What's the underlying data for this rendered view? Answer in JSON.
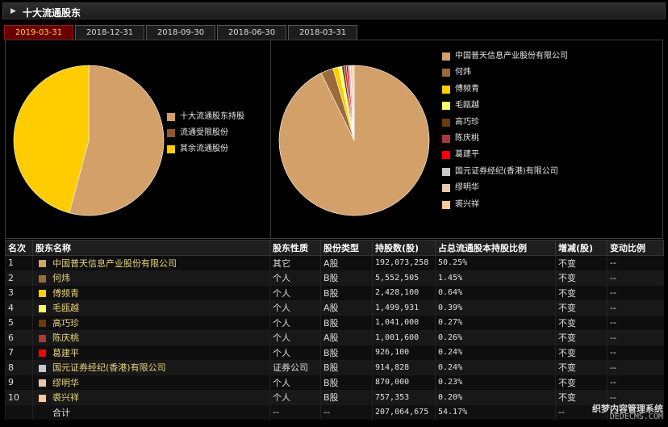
{
  "header": {
    "title": "十大流通股东"
  },
  "tabs": [
    {
      "label": "2019-03-31",
      "active": true
    },
    {
      "label": "2018-12-31",
      "active": false
    },
    {
      "label": "2018-09-30",
      "active": false
    },
    {
      "label": "2018-06-30",
      "active": false
    },
    {
      "label": "2018-03-31",
      "active": false
    }
  ],
  "chart_data": [
    {
      "type": "pie",
      "slices": [
        {
          "label": "十大流通股东持股",
          "value": 54.17,
          "color": "#d4a06a"
        },
        {
          "label": "流通受限股份",
          "value": 0.0,
          "color": "#8c5a2b"
        },
        {
          "label": "其余流通股份",
          "value": 45.83,
          "color": "#ffcc00"
        }
      ]
    },
    {
      "type": "pie",
      "slices": [
        {
          "label": "中国普天信息产业股份有限公司",
          "value": 50.25,
          "color": "#d4a06a"
        },
        {
          "label": "何炜",
          "value": 1.45,
          "color": "#9a6a3a"
        },
        {
          "label": "傅频青",
          "value": 0.64,
          "color": "#ffcc00"
        },
        {
          "label": "毛瓯越",
          "value": 0.39,
          "color": "#ffff66"
        },
        {
          "label": "高巧珍",
          "value": 0.27,
          "color": "#6b3a0c"
        },
        {
          "label": "陈庆桃",
          "value": 0.26,
          "color": "#a83a3a"
        },
        {
          "label": "葛建平",
          "value": 0.24,
          "color": "#ff0000"
        },
        {
          "label": "国元证券经纪(香港)有限公司",
          "value": 0.24,
          "color": "#c8c8c8"
        },
        {
          "label": "缪明华",
          "value": 0.23,
          "color": "#e8c8a8"
        },
        {
          "label": "裘兴祥",
          "value": 0.2,
          "color": "#ffc89a"
        }
      ]
    }
  ],
  "table": {
    "headers": [
      "名次",
      "股东名称",
      "股东性质",
      "股份类型",
      "持股数(股)",
      "占总流通股本持股比例",
      "增减(股)",
      "变动比例"
    ],
    "rows": [
      {
        "rank": "1",
        "name": "中国普天信息产业股份有限公司",
        "nature": "其它",
        "type": "A股",
        "shares": "192,073,258",
        "ratio": "50.25%",
        "change": "不变",
        "pct": "--",
        "color": "#d4a06a"
      },
      {
        "rank": "2",
        "name": "何炜",
        "nature": "个人",
        "type": "B股",
        "shares": "5,552,505",
        "ratio": "1.45%",
        "change": "不变",
        "pct": "--",
        "color": "#9a6a3a"
      },
      {
        "rank": "3",
        "name": "傅频青",
        "nature": "个人",
        "type": "B股",
        "shares": "2,428,100",
        "ratio": "0.64%",
        "change": "不变",
        "pct": "--",
        "color": "#ffcc00"
      },
      {
        "rank": "4",
        "name": "毛瓯越",
        "nature": "个人",
        "type": "A股",
        "shares": "1,499,931",
        "ratio": "0.39%",
        "change": "不变",
        "pct": "--",
        "color": "#ffff66"
      },
      {
        "rank": "5",
        "name": "高巧珍",
        "nature": "个人",
        "type": "B股",
        "shares": "1,041,000",
        "ratio": "0.27%",
        "change": "不变",
        "pct": "--",
        "color": "#6b3a0c"
      },
      {
        "rank": "6",
        "name": "陈庆桃",
        "nature": "个人",
        "type": "A股",
        "shares": "1,001,600",
        "ratio": "0.26%",
        "change": "不变",
        "pct": "--",
        "color": "#a83a3a"
      },
      {
        "rank": "7",
        "name": "葛建平",
        "nature": "个人",
        "type": "B股",
        "shares": "926,100",
        "ratio": "0.24%",
        "change": "不变",
        "pct": "--",
        "color": "#ff0000"
      },
      {
        "rank": "8",
        "name": "国元证券经纪(香港)有限公司",
        "nature": "证券公司",
        "type": "B股",
        "shares": "914,828",
        "ratio": "0.24%",
        "change": "不变",
        "pct": "--",
        "color": "#c8c8c8"
      },
      {
        "rank": "9",
        "name": "缪明华",
        "nature": "个人",
        "type": "B股",
        "shares": "870,000",
        "ratio": "0.23%",
        "change": "不变",
        "pct": "--",
        "color": "#e8c8a8"
      },
      {
        "rank": "10",
        "name": "裘兴祥",
        "nature": "个人",
        "type": "B股",
        "shares": "757,353",
        "ratio": "0.20%",
        "change": "不变",
        "pct": "--",
        "color": "#ffc89a"
      }
    ],
    "total": {
      "label": "合计",
      "nature": "--",
      "type": "--",
      "shares": "207,064,675",
      "ratio": "54.17%",
      "change": "--",
      "pct": "--"
    }
  },
  "watermark": {
    "line1": "织梦内容管理系统",
    "line2": "DEDECMS.COM"
  }
}
